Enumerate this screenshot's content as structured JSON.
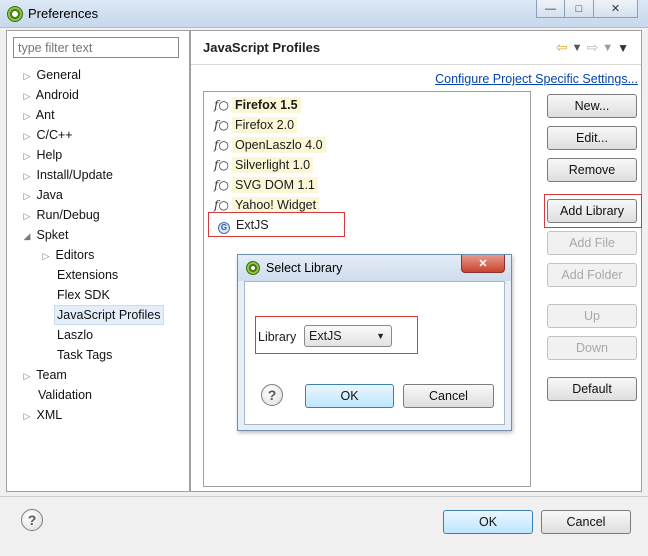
{
  "window": {
    "title": "Preferences",
    "minimize": "—",
    "maximize": "□",
    "close": "✕"
  },
  "filter": {
    "placeholder": "type filter text"
  },
  "tree": [
    {
      "label": "General",
      "twisty": "▷"
    },
    {
      "label": "Android",
      "twisty": "▷"
    },
    {
      "label": "Ant",
      "twisty": "▷"
    },
    {
      "label": "C/C++",
      "twisty": "▷"
    },
    {
      "label": "Help",
      "twisty": "▷"
    },
    {
      "label": "Install/Update",
      "twisty": "▷"
    },
    {
      "label": "Java",
      "twisty": "▷"
    },
    {
      "label": "Run/Debug",
      "twisty": "▷"
    },
    {
      "label": "Spket",
      "twisty": "◢"
    },
    {
      "label": "Editors",
      "twisty": "▷"
    },
    {
      "label": "Extensions",
      "twisty": ""
    },
    {
      "label": "Flex SDK",
      "twisty": ""
    },
    {
      "label": "JavaScript Profiles",
      "twisty": ""
    },
    {
      "label": "Laszlo",
      "twisty": ""
    },
    {
      "label": "Task Tags",
      "twisty": ""
    },
    {
      "label": "Team",
      "twisty": "▷"
    },
    {
      "label": "Validation",
      "twisty": ""
    },
    {
      "label": "XML",
      "twisty": "▷"
    }
  ],
  "panel": {
    "title": "JavaScript Profiles",
    "configure_link": "Configure Project Specific Settings...",
    "nav_back_icon": "back-arrow-icon",
    "nav_forward_icon": "forward-arrow-icon"
  },
  "profiles": [
    {
      "label": "Firefox 1.5",
      "icon": "fx",
      "bold": true
    },
    {
      "label": "Firefox 2.0",
      "icon": "fx",
      "bold": false
    },
    {
      "label": "OpenLaszlo 4.0",
      "icon": "fx",
      "bold": false
    },
    {
      "label": "Silverlight 1.0",
      "icon": "fx",
      "bold": false
    },
    {
      "label": "SVG DOM 1.1",
      "icon": "fx",
      "bold": false
    },
    {
      "label": "Yahoo! Widget",
      "icon": "fx",
      "bold": false
    },
    {
      "label": "ExtJS",
      "icon": "library",
      "bold": false
    }
  ],
  "side_buttons": {
    "new": "New...",
    "edit": "Edit...",
    "remove": "Remove",
    "add_library": "Add Library",
    "add_file": "Add File",
    "add_folder": "Add Folder",
    "up": "Up",
    "down": "Down",
    "default": "Default"
  },
  "dialog": {
    "title": "Select Library",
    "close": "✕",
    "library_label": "Library",
    "library_value": "ExtJS",
    "ok": "OK",
    "cancel": "Cancel",
    "help": "?"
  },
  "footer": {
    "ok": "OK",
    "cancel": "Cancel",
    "help": "?"
  },
  "colors": {
    "highlight_border": "#d63a3a",
    "link": "#0645ad",
    "primary_button": "#bee6fd"
  }
}
